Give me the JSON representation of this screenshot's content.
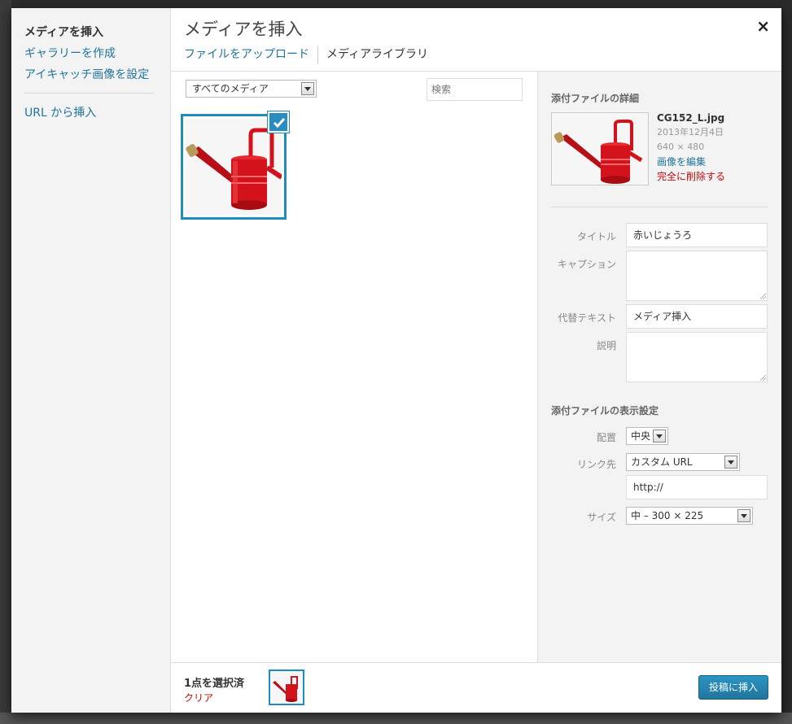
{
  "menu": {
    "items": [
      {
        "label": "メディアを挿入"
      },
      {
        "label": "ギャラリーを作成"
      },
      {
        "label": "アイキャッチ画像を設定"
      },
      {
        "label": "URL から挿入"
      }
    ]
  },
  "header": {
    "title": "メディアを挿入",
    "close_label": "×",
    "tabs": [
      {
        "label": "ファイルをアップロード"
      },
      {
        "label": "メディアライブラリ"
      }
    ]
  },
  "toolbar": {
    "filter_value": "すべてのメディア",
    "search_placeholder": "検索"
  },
  "details": {
    "heading": "添付ファイルの詳細",
    "filename": "CG152_L.jpg",
    "date": "2013年12月4日",
    "dimensions": "640 × 480",
    "edit_label": "画像を編集",
    "delete_label": "完全に削除する",
    "fields": {
      "title_label": "タイトル",
      "title_value": "赤いじょうろ",
      "caption_label": "キャプション",
      "caption_value": "",
      "alt_label": "代替テキスト",
      "alt_value": "メディア挿入",
      "description_label": "説明",
      "description_value": ""
    }
  },
  "display": {
    "heading": "添付ファイルの表示設定",
    "align_label": "配置",
    "align_value": "中央",
    "link_label": "リンク先",
    "link_value": "カスタム URL",
    "link_url": "http://",
    "size_label": "サイズ",
    "size_value": "中 – 300 × 225"
  },
  "footer": {
    "count": "1点を選択済",
    "clear_label": "クリア",
    "insert_label": "投稿に挿入"
  },
  "colors": {
    "accent": "#1e8cbe",
    "link": "#21759b",
    "delete": "#bc0b0b",
    "watering_can": "#d3121b"
  }
}
